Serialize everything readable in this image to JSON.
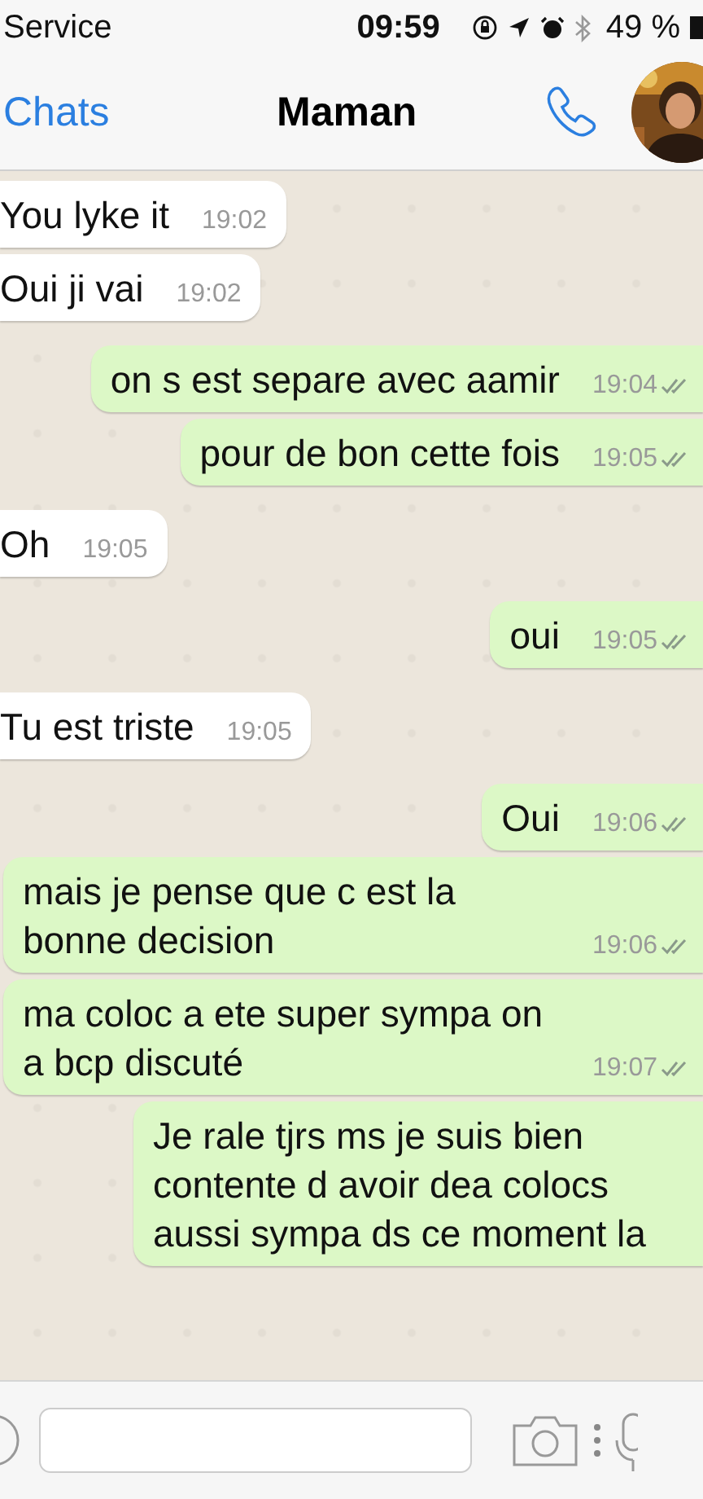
{
  "status_bar": {
    "carrier": "Service",
    "time": "09:59",
    "battery": "49 %"
  },
  "nav": {
    "back": "Chats",
    "title": "Maman"
  },
  "messages": [
    {
      "outgoing": false,
      "text": "You lyke it",
      "time": "19:02"
    },
    {
      "outgoing": false,
      "text": "Oui ji vai",
      "time": "19:02"
    },
    {
      "outgoing": true,
      "text": "on s est separe avec aamir",
      "time": "19:04",
      "read": true
    },
    {
      "outgoing": true,
      "text": "pour de bon cette fois",
      "time": "19:05",
      "read": true
    },
    {
      "outgoing": false,
      "text": "Oh",
      "time": "19:05"
    },
    {
      "outgoing": true,
      "text": "oui",
      "time": "19:05",
      "read": true
    },
    {
      "outgoing": false,
      "text": "Tu est triste",
      "time": "19:05"
    },
    {
      "outgoing": true,
      "text": "Oui",
      "time": "19:06",
      "read": true
    },
    {
      "outgoing": true,
      "text": "mais je pense que c est la bonne decision",
      "time": "19:06",
      "read": true
    },
    {
      "outgoing": true,
      "text": "ma coloc a ete super sympa on a bcp discuté",
      "time": "19:07",
      "read": true
    },
    {
      "outgoing": true,
      "text": "Je rale tjrs ms je suis bien contente d avoir dea colocs aussi sympa ds ce moment la"
    }
  ]
}
